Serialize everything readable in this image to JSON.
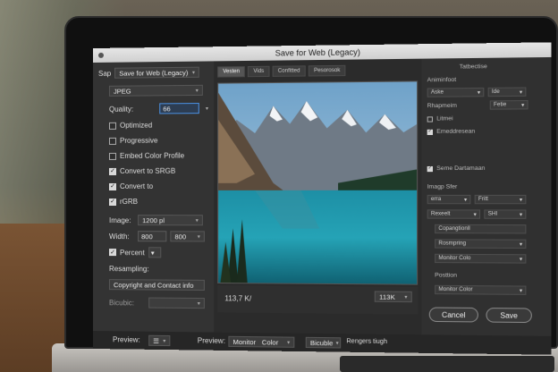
{
  "window": {
    "title": "Save for Web (Legacy)"
  },
  "left_panel": {
    "preset_label": "Sap",
    "preset_value": "Save for Web (Legacy)",
    "format_value": "JPEG",
    "quality_label": "Quality:",
    "quality_value": "66",
    "checkboxes": [
      {
        "label": "Optimized",
        "checked": false
      },
      {
        "label": "Progressive",
        "checked": false
      },
      {
        "label": "Embed Color Profile",
        "checked": false
      },
      {
        "label": "Convert to SRGB",
        "checked": true
      },
      {
        "label": "Convert to",
        "checked": true
      },
      {
        "label": "rGRB",
        "checked": true
      }
    ],
    "image_label": "Image:",
    "image_value": "1200 pl",
    "width_label": "Width:",
    "width_value": "800",
    "height_value": "800",
    "percent_label": "Percent",
    "resampling_label": "Resampling:",
    "metadata_value": "Copyright and Contact info",
    "bicubic_label": "Bicubic:"
  },
  "preview": {
    "tabs": [
      "Vesten",
      "Vids",
      "Confitted",
      "Pesorosok"
    ],
    "size_readout": "113,7 K/",
    "size_select": "113K"
  },
  "right_panel": {
    "header": "Tatbectise",
    "section1_label": "Animinfoot",
    "row1_a": "Aske",
    "row1_b": "Ide",
    "row2_label": "Rhapmeim",
    "row2_b": "Fetie",
    "checks": [
      {
        "label": "Litmei",
        "checked": false
      },
      {
        "label": "Emeddresean",
        "checked": true
      }
    ],
    "convert_label": "Seme Dartamaan",
    "image_size_label": "Imagp Sfer",
    "row3_a": "erra",
    "row3_b": "Fritt",
    "row4_a": "Rexeelt",
    "row4_b": "SHI",
    "copyright_value": "Copangtionll",
    "resampling_value": "Rosmpring",
    "color_value": "Monitor Colo",
    "position_label": "Posttion",
    "monitor_color_value": "Monitor Color",
    "cancel_label": "Cancel",
    "save_label": "Save"
  },
  "bottom_bar": {
    "preview_label": "Preview:",
    "preview2_label": "Preview:",
    "monitor_value": "Monitor",
    "color_value": "Color",
    "bicubic_value": "Bicuble",
    "rendering_text": "Rengers tiugh"
  },
  "colors": {
    "focus_accent": "#4a90e2",
    "panel_bg": "#333333",
    "screen_bg": "#2b2b2b"
  }
}
